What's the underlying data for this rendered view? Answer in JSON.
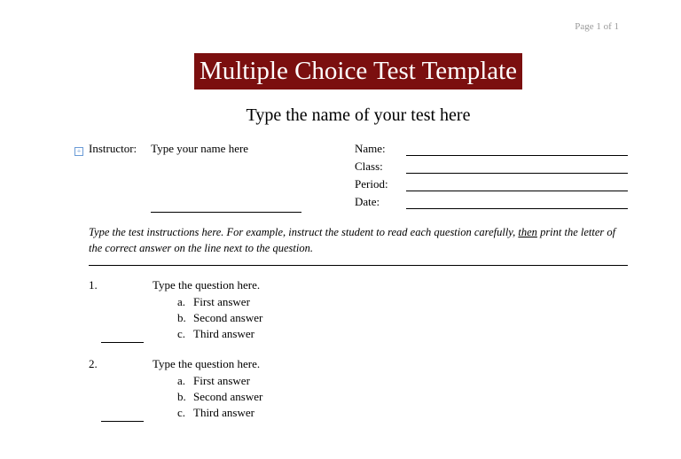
{
  "page_number": "Page 1 of 1",
  "title": "Multiple Choice Test Template",
  "subtitle": "Type the name of your test here",
  "instructor_label": "Instructor:",
  "instructor_value": "Type your name here",
  "fields": [
    {
      "label": "Name:"
    },
    {
      "label": "Class:"
    },
    {
      "label": "Period:"
    },
    {
      "label": "Date:"
    }
  ],
  "instructions_pre": "Type the test instructions here.  For example, instruct the student to read each question carefully, ",
  "instructions_then": "then",
  "instructions_post": " print the letter of the correct answer on the line next to the question.",
  "questions": [
    {
      "number": "1.",
      "text": "Type the question here.",
      "answers": [
        {
          "letter": "a.",
          "text": "First answer"
        },
        {
          "letter": "b.",
          "text": "Second answer"
        },
        {
          "letter": "c.",
          "text": "Third answer"
        }
      ]
    },
    {
      "number": "2.",
      "text": "Type the question here.",
      "answers": [
        {
          "letter": "a.",
          "text": "First answer"
        },
        {
          "letter": "b.",
          "text": "Second answer"
        },
        {
          "letter": "c.",
          "text": "Third answer"
        }
      ]
    }
  ]
}
